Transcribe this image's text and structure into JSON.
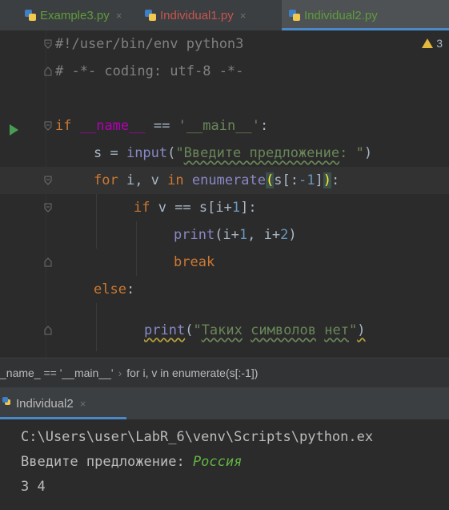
{
  "tabs": [
    {
      "label": "Example3.py",
      "active": false,
      "color": "#5f9c3a"
    },
    {
      "label": "Individual1.py",
      "active": false,
      "color": "#c75450"
    },
    {
      "label": "Individual2.py",
      "active": true,
      "color": "#5f9c3a"
    }
  ],
  "warnings": {
    "count": "3",
    "icon": "warning-triangle-icon",
    "color": "#e2b93d"
  },
  "code": {
    "line1": "#!/user/bin/env python3",
    "line2": "# -*- coding: utf-8 -*-",
    "line4_kw": "if",
    "line4_name": "__name__",
    "line4_op": " == ",
    "line4_str": "'__main__'",
    "line4_colon": ":",
    "line5_a": "s = ",
    "line5_fn": "input",
    "line5_p1": "(",
    "line5_str_q1": "\"",
    "line5_str_wavy": "Введите предложение",
    "line5_str_rest": ": \"",
    "line5_p2": ")",
    "line6_for": "for",
    "line6_vars": " i, v ",
    "line6_in": "in",
    "line6_sp": " ",
    "line6_fn": "enumerate",
    "line6_lp": "(",
    "line6_arg_a": "s[:",
    "line6_num": "-1",
    "line6_arg_b": "]",
    "line6_rp": ")",
    "line6_colon": ":",
    "line7_if": "if",
    "line7_a": " v == s[i+",
    "line7_num": "1",
    "line7_b": "]:",
    "line8_fn": "print",
    "line8_a": "(i+",
    "line8_n1": "1",
    "line8_b": ", i+",
    "line8_n2": "2",
    "line8_c": ")",
    "line9_kw": "break",
    "line10_kw": "else",
    "line10_colon": ":",
    "line11_fn": "print",
    "line11_lp": "(",
    "line11_q1": "\"",
    "line11_w1": "Таких",
    "line11_sp1": " ",
    "line11_w2": "символов",
    "line11_sp2": " ",
    "line11_w3": "нет",
    "line11_q2": "\"",
    "line11_rp": ")"
  },
  "breadcrumb": {
    "item1": "_name_ == '__main__'",
    "separator": "›",
    "item2": "for i, v in enumerate(s[:-1])"
  },
  "run": {
    "tab_label": "Individual2",
    "close": "×",
    "console_line1": "C:\\Users\\user\\LabR_6\\venv\\Scripts\\python.ex",
    "console_prompt": "Введите предложение: ",
    "console_input": "Россия",
    "console_output": "3 4"
  },
  "colors": {
    "accent": "#4a88c7",
    "run_arrow": "#499c54",
    "keyword": "#cc7832",
    "string": "#6a8759"
  }
}
